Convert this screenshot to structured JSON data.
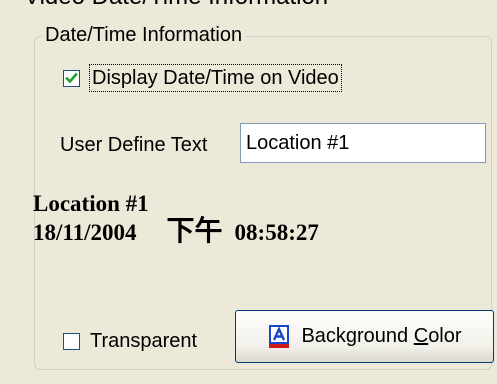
{
  "header": {
    "cut_off_title": "Video Date/Time Information"
  },
  "group": {
    "legend": "Date/Time Information"
  },
  "display_checkbox": {
    "label": "Display Date/Time on Video",
    "checked": true
  },
  "user_text": {
    "label": "User Define Text",
    "value": "Location #1"
  },
  "preview": {
    "line1": "Location #1",
    "date": "18/11/2004",
    "ampm": "下午",
    "time": "08:58:27"
  },
  "transparent_checkbox": {
    "label": "Transparent",
    "checked": false
  },
  "background_button": {
    "label_before": "Background ",
    "label_accel": "C",
    "label_after": "olor",
    "icon": "font-color-icon"
  },
  "colors": {
    "window_bg": "#ece9d8",
    "groupbox_border": "#d0d0bf",
    "input_border": "#7f9db9",
    "checkbox_border": "#1c5180",
    "checkmark": "#21a121",
    "button_border": "#003c74",
    "icon_blue": "#1a47c8",
    "icon_red": "#d01818"
  }
}
